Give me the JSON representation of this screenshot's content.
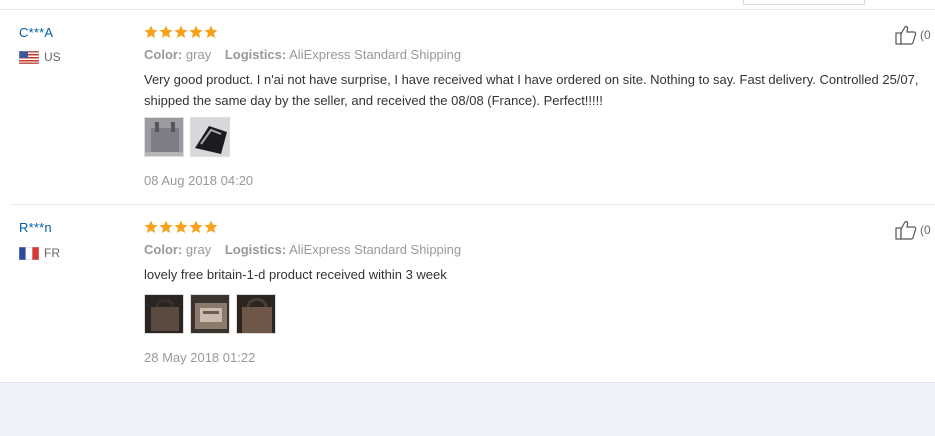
{
  "reviews": [
    {
      "user": "C***A",
      "country": "US",
      "rating": 5,
      "color_label": "Color:",
      "color_value": "gray",
      "logistics_label": "Logistics:",
      "logistics_value": "AliExpress Standard Shipping",
      "text": "Very good product. I n'ai not have surprise, I have received what I have ordered on site. Nothing to say. Fast delivery. Controlled 25/07, shipped the same day by the seller, and received the 08/08 (France). Perfect!!!!!",
      "photos": [
        "photo-1",
        "photo-2"
      ],
      "date": "08 Aug 2018 04:20",
      "helpful_count": "(0"
    },
    {
      "user": "R***n",
      "country": "FR",
      "rating": 5,
      "color_label": "Color:",
      "color_value": "gray",
      "logistics_label": "Logistics:",
      "logistics_value": "AliExpress Standard Shipping",
      "text": "lovely free britain-1-d product received within 3 week",
      "photos": [
        "photo-1",
        "photo-2",
        "photo-3"
      ],
      "date": "28 May 2018 01:22",
      "helpful_count": "(0"
    }
  ],
  "colors": {
    "username": "#005ea7",
    "star": "#f7a21c",
    "muted": "#999999",
    "footer_bg": "#eef2f9"
  },
  "icons": {
    "star": "star-icon",
    "helpful": "thumbs-up-icon"
  }
}
